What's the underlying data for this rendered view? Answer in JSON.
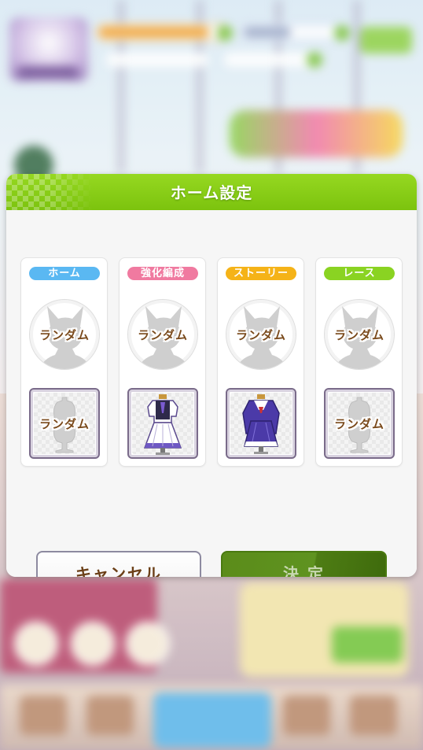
{
  "dialog": {
    "title": "ホーム設定",
    "header_color": "#8ccf19",
    "slots": [
      {
        "tag": "ホーム",
        "tag_color": "#5ab8f2",
        "character": "ランダム",
        "outfit": "ランダム",
        "outfit_icon": "mannequin-icon"
      },
      {
        "tag": "強化編成",
        "tag_color": "#f07aa0",
        "character": "ランダム",
        "outfit": "",
        "outfit_icon": "white-purple-uniform-icon"
      },
      {
        "tag": "ストーリー",
        "tag_color": "#f5b318",
        "character": "ランダム",
        "outfit": "",
        "outfit_icon": "purple-winter-uniform-icon"
      },
      {
        "tag": "レース",
        "tag_color": "#8ad322",
        "character": "ランダム",
        "outfit": "ランダム",
        "outfit_icon": "mannequin-icon"
      }
    ],
    "buttons": {
      "cancel": "キャンセル",
      "confirm": "決 定",
      "confirm_enabled": false
    }
  }
}
